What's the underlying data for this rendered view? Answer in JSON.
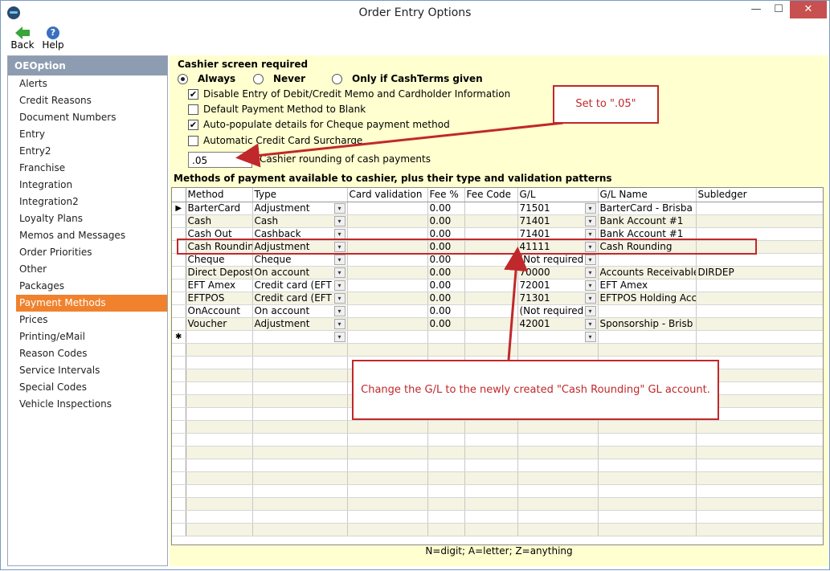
{
  "window": {
    "title": "Order Entry Options",
    "min_glyph": "—",
    "max_glyph": "☐",
    "close_glyph": "✕"
  },
  "toolbar": {
    "back_label": "Back",
    "help_label": "Help",
    "help_glyph": "?"
  },
  "sidebar": {
    "header": "OEOption",
    "items": [
      {
        "label": "Alerts"
      },
      {
        "label": "Credit Reasons"
      },
      {
        "label": "Document Numbers"
      },
      {
        "label": "Entry"
      },
      {
        "label": "Entry2"
      },
      {
        "label": "Franchise"
      },
      {
        "label": "Integration"
      },
      {
        "label": "Integration2"
      },
      {
        "label": "Loyalty Plans"
      },
      {
        "label": "Memos and Messages"
      },
      {
        "label": "Order Priorities"
      },
      {
        "label": "Other"
      },
      {
        "label": "Packages"
      },
      {
        "label": "Payment Methods"
      },
      {
        "label": "Prices"
      },
      {
        "label": "Printing/eMail"
      },
      {
        "label": "Reason Codes"
      },
      {
        "label": "Service Intervals"
      },
      {
        "label": "Special Codes"
      },
      {
        "label": "Vehicle Inspections"
      }
    ],
    "selected": "Payment Methods"
  },
  "settings": {
    "cashier_title": "Cashier screen required",
    "radio_always": "Always",
    "radio_never": "Never",
    "radio_cashterms": "Only if CashTerms given",
    "radio_selected": "Always",
    "chk_disable_entry": "Disable Entry of Debit/Credit Memo and Cardholder Information",
    "chk_disable_entry_checked": true,
    "chk_default_payment": "Default Payment Method to Blank",
    "chk_default_payment_checked": false,
    "chk_autopopulate": "Auto-populate details for Cheque payment method",
    "chk_autopopulate_checked": true,
    "chk_surcharge": "Automatic Credit Card Surcharge",
    "chk_surcharge_checked": false,
    "check_glyph": "✔",
    "rounding_value": ".05",
    "rounding_arrow": "▼",
    "rounding_label": "Cashier rounding of cash payments",
    "methods_title": "Methods of payment available to cashier, plus their type and validation patterns"
  },
  "grid": {
    "columns": {
      "method": "Method",
      "type": "Type",
      "card": "Card validation",
      "fee": "Fee %",
      "feecode": "Fee Code",
      "gl": "G/L",
      "glname": "G/L Name",
      "sub": "Subledger"
    },
    "current_row_glyph": "▶",
    "new_row_glyph": "✱",
    "dropdown_glyph": "▾",
    "rows": [
      {
        "method": "BarterCard",
        "type": "Adjustment",
        "card": "",
        "fee": "0.00",
        "feecode": "",
        "gl": "71501",
        "glname": "BarterCard - Brisba",
        "sub": ""
      },
      {
        "method": "Cash",
        "type": "Cash",
        "card": "",
        "fee": "0.00",
        "feecode": "",
        "gl": "71401",
        "glname": "Bank Account #1",
        "sub": ""
      },
      {
        "method": "Cash Out",
        "type": "Cashback",
        "card": "",
        "fee": "0.00",
        "feecode": "",
        "gl": "71401",
        "glname": "Bank Account #1",
        "sub": ""
      },
      {
        "method": "Cash Roundin",
        "type": "Adjustment",
        "card": "",
        "fee": "0.00",
        "feecode": "",
        "gl": "41111",
        "glname": "Cash Rounding",
        "sub": ""
      },
      {
        "method": "Cheque",
        "type": "Cheque",
        "card": "",
        "fee": "0.00",
        "feecode": "",
        "gl": "(Not required",
        "glname": "",
        "sub": ""
      },
      {
        "method": "Direct Depost",
        "type": "On account",
        "card": "",
        "fee": "0.00",
        "feecode": "",
        "gl": "70000",
        "glname": "Accounts Receivable",
        "sub": "DIRDEP"
      },
      {
        "method": "EFT Amex",
        "type": "Credit card (EFT",
        "card": "",
        "fee": "0.00",
        "feecode": "",
        "gl": "72001",
        "glname": "EFT Amex",
        "sub": ""
      },
      {
        "method": "EFTPOS",
        "type": "Credit card (EFT",
        "card": "",
        "fee": "0.00",
        "feecode": "",
        "gl": "71301",
        "glname": "EFTPOS Holding Acc",
        "sub": ""
      },
      {
        "method": "OnAccount",
        "type": "On account",
        "card": "",
        "fee": "0.00",
        "feecode": "",
        "gl": "(Not required",
        "glname": "",
        "sub": ""
      },
      {
        "method": "Voucher",
        "type": "Adjustment",
        "card": "",
        "fee": "0.00",
        "feecode": "",
        "gl": "42001",
        "glname": "Sponsorship - Brisb",
        "sub": ""
      }
    ],
    "footer": "N=digit; A=letter; Z=anything"
  },
  "annotations": {
    "callout_rounding": "Set to \".05\"",
    "callout_gl": "Change the G/L to the newly created \"Cash Rounding\" GL account."
  },
  "colors": {
    "accent": "#f0822e",
    "annotation": "#c0282b",
    "content_bg": "#ffffcf",
    "sidebar_header": "#8d9cb0"
  }
}
